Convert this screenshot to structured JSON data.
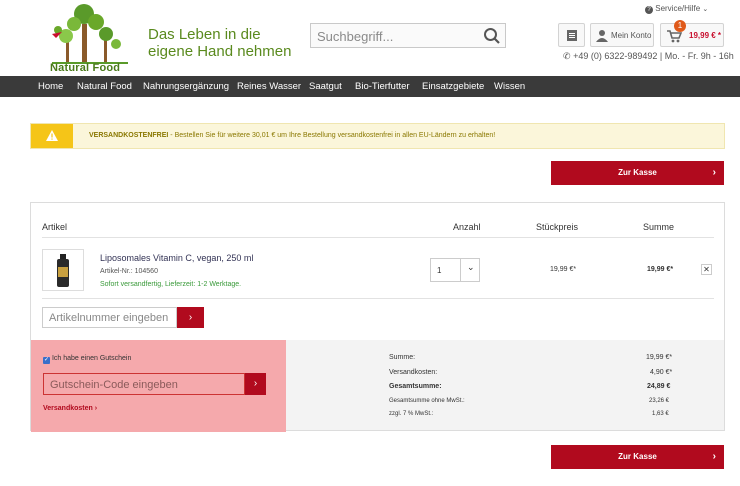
{
  "header": {
    "logo_text": "Natural Food",
    "tagline_line1": "Das Leben in die",
    "tagline_line2": "eigene Hand nehmen",
    "search_placeholder": "Suchbegriff...",
    "service_label": "Service/Hilfe",
    "account_label": "Mein Konto",
    "cart_count": "1",
    "cart_total": "19,99 € *",
    "phone": "+49 (0) 6322-989492 | Mo. - Fr. 9h - 16h"
  },
  "nav": {
    "items": [
      "Home",
      "Natural Food",
      "Nahrungsergänzung",
      "Reines Wasser",
      "Saatgut",
      "Bio-Tierfutter",
      "Einsatzgebiete",
      "Wissen"
    ]
  },
  "banner": {
    "bold": "VERSANDKOSTENFREI",
    "text": " - Bestellen Sie für weitere 30,01 € um Ihre Bestellung versandkostenfrei in allen EU-Ländern zu erhalten!"
  },
  "checkout_label": "Zur Kasse",
  "cart": {
    "headers": {
      "article": "Artikel",
      "qty": "Anzahl",
      "unit": "Stückpreis",
      "sum": "Summe"
    },
    "item": {
      "name": "Liposomales Vitamin C, vegan, 250 ml",
      "number": "Artikel-Nr.: 104560",
      "shipping": "Sofort versandfertig, Lieferzeit: 1-2 Werktage.",
      "qty": "1",
      "unit_price": "19,99 €*",
      "sum": "19,99 €*"
    },
    "artnr_placeholder": "Artikelnummer eingeben"
  },
  "voucher": {
    "checkbox_label": "Ich habe einen Gutschein",
    "placeholder": "Gutschein-Code eingeben",
    "shipping_link": "Versandkosten"
  },
  "totals": {
    "rows": [
      {
        "label": "Summe:",
        "value": "19,99 €*"
      },
      {
        "label": "Versandkosten:",
        "value": "4,90 €*"
      },
      {
        "label": "Gesamtsumme:",
        "value": "24,89 €"
      },
      {
        "label": "Gesamtsumme ohne MwSt.:",
        "value": "23,26 €"
      },
      {
        "label": "zzgl. 7 % MwSt.:",
        "value": "1,63 €"
      }
    ]
  },
  "colors": {
    "brand_red": "#b10a1e",
    "brand_green": "#5a8a1e",
    "nav_bg": "#3a3a3a",
    "voucher_bg": "#f5a9ac"
  }
}
